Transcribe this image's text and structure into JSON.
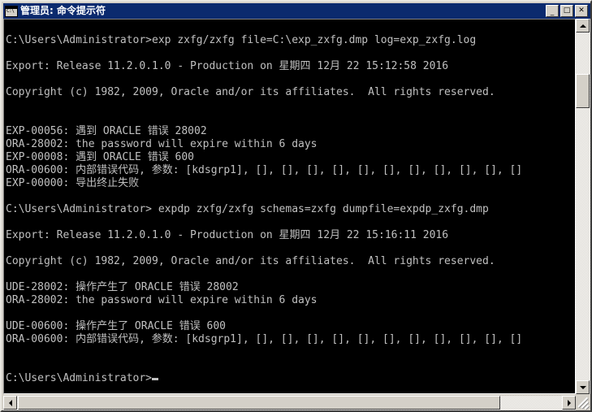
{
  "window": {
    "title": "管理员: 命令提示符",
    "icon": "console-window-icon",
    "titlebar_color": "#0b2a6e",
    "chrome_color": "#d4d0c8",
    "buttons": [
      {
        "name": "minimize-button",
        "glyph": "_"
      },
      {
        "name": "maximize-button",
        "glyph": "□"
      },
      {
        "name": "close-button",
        "glyph": "✕"
      }
    ]
  },
  "console": {
    "background": "#000000",
    "foreground": "#c0c0c0",
    "lines": [
      "",
      "C:\\Users\\Administrator>exp zxfg/zxfg file=C:\\exp_zxfg.dmp log=exp_zxfg.log",
      "",
      "Export: Release 11.2.0.1.0 - Production on 星期四 12月 22 15:12:58 2016",
      "",
      "Copyright (c) 1982, 2009, Oracle and/or its affiliates.  All rights reserved.",
      "",
      "",
      "EXP-00056: 遇到 ORACLE 错误 28002",
      "ORA-28002: the password will expire within 6 days",
      "EXP-00008: 遇到 ORACLE 错误 600",
      "ORA-00600: 内部错误代码, 参数: [kdsgrp1], [], [], [], [], [], [], [], [], [], [], []",
      "EXP-00000: 导出终止失败",
      "",
      "C:\\Users\\Administrator> expdp zxfg/zxfg schemas=zxfg dumpfile=expdp_zxfg.dmp",
      "",
      "Export: Release 11.2.0.1.0 - Production on 星期四 12月 22 15:16:11 2016",
      "",
      "Copyright (c) 1982, 2009, Oracle and/or its affiliates.  All rights reserved.",
      "",
      "UDE-28002: 操作产生了 ORACLE 错误 28002",
      "ORA-28002: the password will expire within 6 days",
      "",
      "UDE-00600: 操作产生了 ORACLE 错误 600",
      "ORA-00600: 内部错误代码, 参数: [kdsgrp1], [], [], [], [], [], [], [], [], [], [], []",
      "",
      ""
    ],
    "prompt": "C:\\Users\\Administrator>"
  },
  "scrollbars": {
    "vertical": {
      "up_arrow": "▲",
      "down_arrow": "▼"
    },
    "horizontal": {
      "left_arrow": "◄",
      "right_arrow": "►"
    }
  }
}
